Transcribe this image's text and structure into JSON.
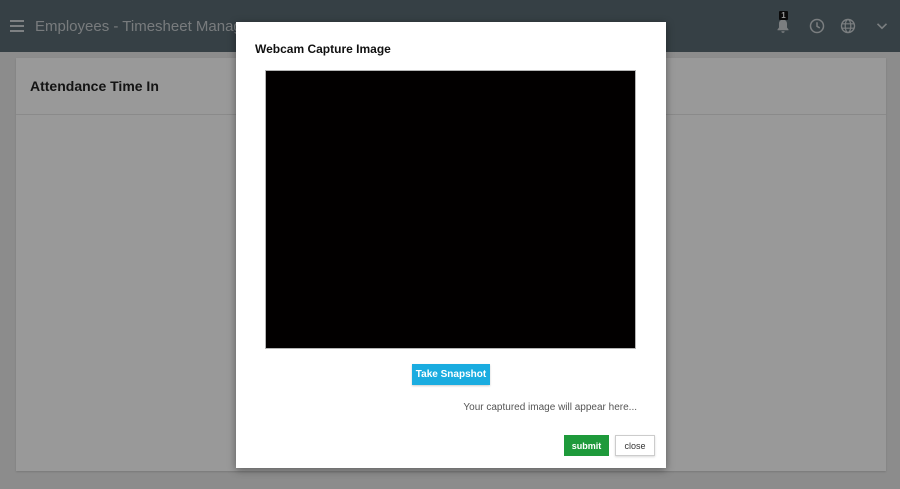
{
  "header": {
    "title": "Employees - Timesheet Manageme",
    "notification_count": "1",
    "icons": [
      "menu-icon",
      "bell-icon",
      "clock-icon",
      "globe-icon",
      "chevron-down-icon"
    ],
    "colors": {
      "bar": "#5a6b73"
    }
  },
  "card": {
    "title": "Attendance Time In"
  },
  "modal": {
    "title": "Webcam Capture Image",
    "snapshot_label": "Take Snapshot",
    "hint": "Your captured image will appear here...",
    "submit_label": "submit",
    "close_label": "close",
    "colors": {
      "snapshot": "#1aace0",
      "submit": "#1e9a3b",
      "video": "#020000"
    }
  }
}
